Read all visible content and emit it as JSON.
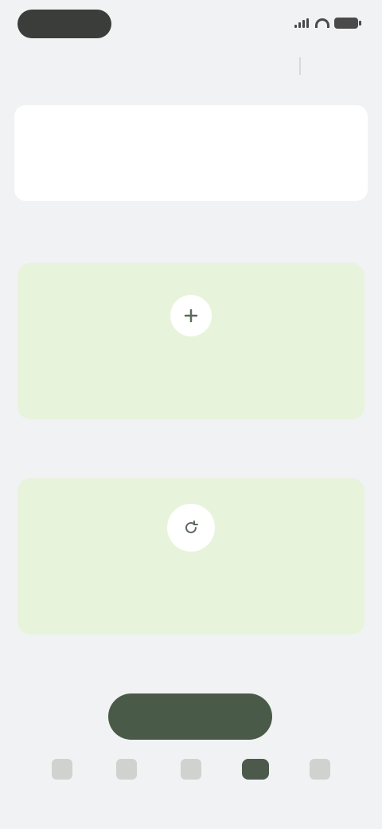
{
  "status_bar": {
    "time": "",
    "icons": [
      "signal-icon",
      "wifi-icon",
      "battery-icon"
    ]
  },
  "header": {
    "title": ""
  },
  "sections": [
    {
      "label": "",
      "card": {
        "icon": "plus-icon",
        "title": "",
        "subtitle": ""
      }
    },
    {
      "label": "",
      "card": {
        "icon": "refresh-icon",
        "title": "",
        "subtitle": ""
      }
    }
  ],
  "primary_button": {
    "label": ""
  },
  "tabs": [
    {
      "icon": "home-icon",
      "label": ""
    },
    {
      "icon": "list-icon",
      "label": ""
    },
    {
      "icon": "calendar-icon",
      "label": ""
    },
    {
      "icon": "wallet-icon",
      "label": "",
      "active": true
    },
    {
      "icon": "profile-icon",
      "label": ""
    }
  ],
  "colors": {
    "background": "#f1f2f4",
    "card_green": "#e8f3dc",
    "accent": "#4a5a48"
  }
}
